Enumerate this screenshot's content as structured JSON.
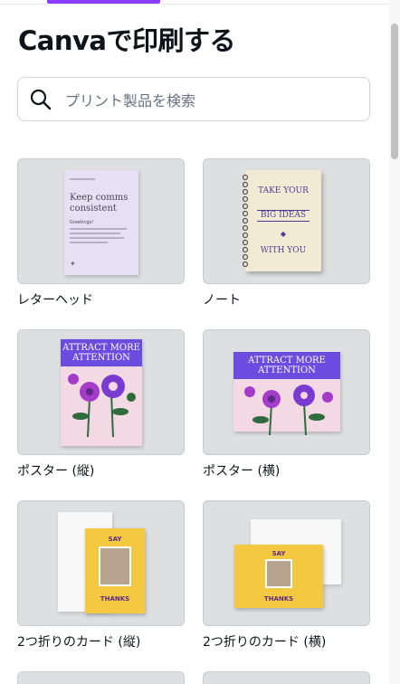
{
  "header": {
    "title": "Canvaで印刷する"
  },
  "search": {
    "placeholder": "プリント製品を検索"
  },
  "products": [
    {
      "label": "レターヘッド"
    },
    {
      "label": "ノート"
    },
    {
      "label": "ポスター (縦)"
    },
    {
      "label": "ポスター (横)"
    },
    {
      "label": "2つ折りのカード (縦)"
    },
    {
      "label": "2つ折りのカード (横)"
    }
  ],
  "thumbnails": {
    "letterhead": {
      "headline": "Keep comms consistent",
      "greeting": "Greetings!"
    },
    "notebook": {
      "line1": "TAKE YOUR",
      "line2": "BIG IDEAS",
      "line3": "WITH YOU"
    },
    "poster_v": {
      "headline": "ATTRACT MORE ATTENTION"
    },
    "poster_h": {
      "headline": "ATTRACT MORE ATTENTION"
    },
    "card_v": {
      "top": "SAY",
      "bottom": "THANKS"
    },
    "card_h": {
      "top": "SAY",
      "bottom": "THANKS"
    }
  },
  "colors": {
    "accent": "#8b3dff",
    "poster_purple": "#6a4de0",
    "card_yellow": "#f5c842"
  }
}
